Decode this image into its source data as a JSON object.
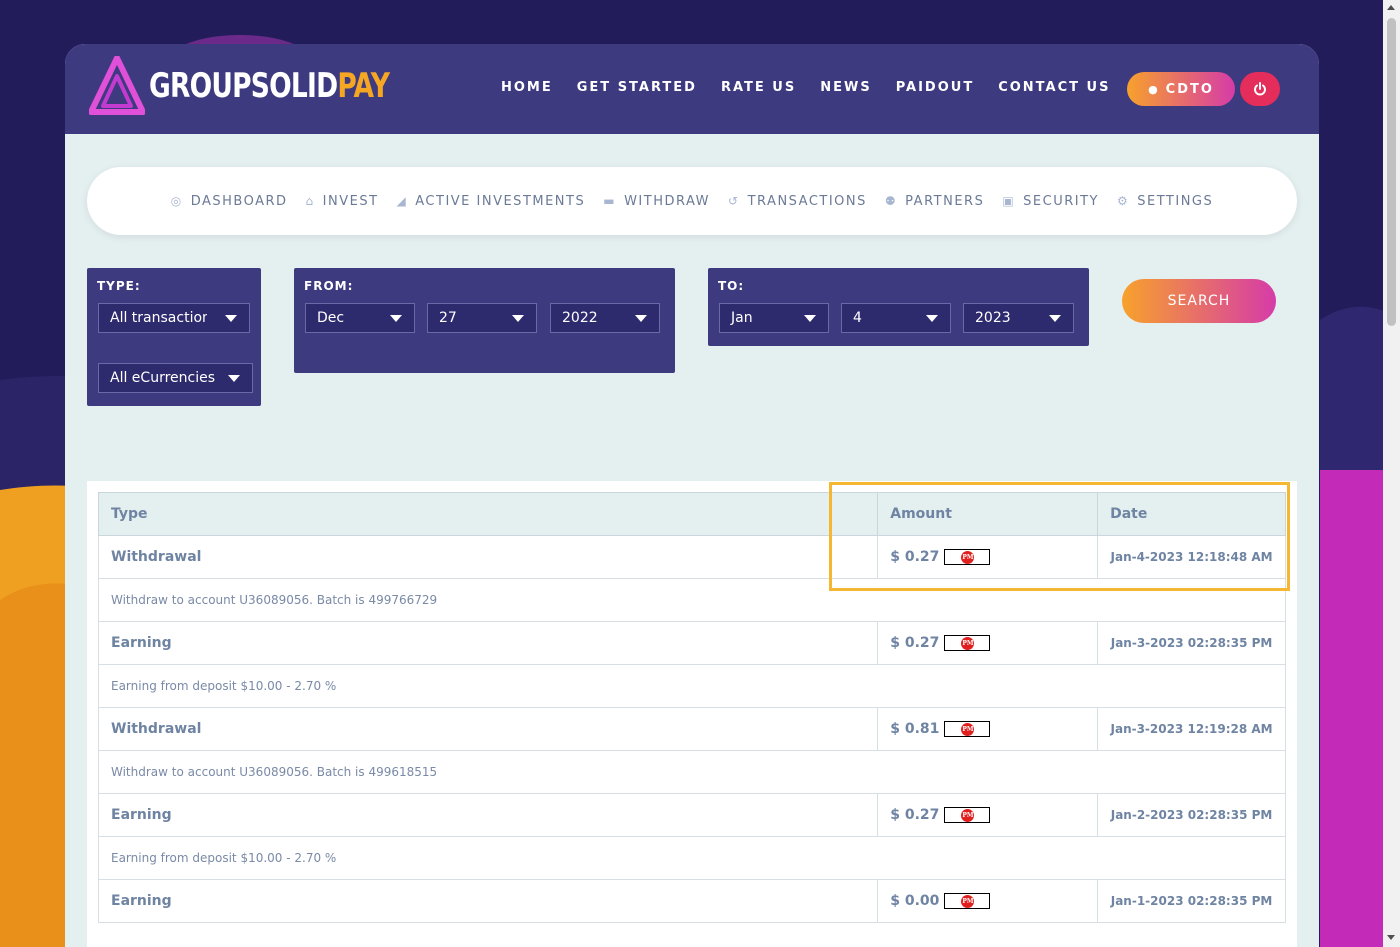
{
  "brand": {
    "logo_part1": "GROUPSOLID",
    "logo_part2": "PAY",
    "accent": "#f5a623",
    "primary": "#3d3a7f"
  },
  "main_nav": [
    "HOME",
    "GET STARTED",
    "RATE US",
    "NEWS",
    "PAIDOUT",
    "CONTACT US"
  ],
  "user": {
    "label": "CDTO",
    "icon": "user-icon",
    "logout_icon": "power-icon"
  },
  "sub_nav": [
    {
      "label": "DASHBOARD",
      "icon": "user-circle-icon"
    },
    {
      "label": "INVEST",
      "icon": "bank-icon"
    },
    {
      "label": "ACTIVE INVESTMENTS",
      "icon": "area-chart-icon"
    },
    {
      "label": "WITHDRAW",
      "icon": "credit-card-icon"
    },
    {
      "label": "TRANSACTIONS",
      "icon": "history-icon"
    },
    {
      "label": "PARTNERS",
      "icon": "users-icon"
    },
    {
      "label": "SECURITY",
      "icon": "lock-icon"
    },
    {
      "label": "SETTINGS",
      "icon": "gear-icon"
    }
  ],
  "filters": {
    "type_label": "TYPE:",
    "type_value": "All transactions",
    "currency_value": "All eCurrencies",
    "from_label": "FROM:",
    "from_month": "Dec",
    "from_day": "27",
    "from_year": "2022",
    "to_label": "TO:",
    "to_month": "Jan",
    "to_day": "4",
    "to_year": "2023",
    "search_label": "SEARCH"
  },
  "table": {
    "headers": [
      "Type",
      "Amount",
      "Date"
    ],
    "rows": [
      {
        "type": "Withdrawal",
        "amount": "$ 0.27",
        "date": "Jan-4-2023 12:18:48 AM",
        "desc": "Withdraw to account U36089056. Batch is 499766729"
      },
      {
        "type": "Earning",
        "amount": "$ 0.27",
        "date": "Jan-3-2023 02:28:35 PM",
        "desc": "Earning from deposit $10.00 - 2.70 %"
      },
      {
        "type": "Withdrawal",
        "amount": "$ 0.81",
        "date": "Jan-3-2023 12:19:28 AM",
        "desc": "Withdraw to account U36089056. Batch is 499618515"
      },
      {
        "type": "Earning",
        "amount": "$ 0.27",
        "date": "Jan-2-2023 02:28:35 PM",
        "desc": "Earning from deposit $10.00 - 2.70 %"
      },
      {
        "type": "Earning",
        "amount": "$ 0.00",
        "date": "Jan-1-2023 02:28:35 PM",
        "desc": ""
      }
    ],
    "currency_badge": "PM"
  }
}
